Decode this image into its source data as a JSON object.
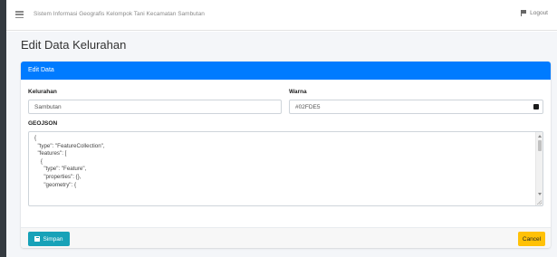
{
  "topbar": {
    "app_title": "Sistem Informasi Geografis Kelompok Tani Kecamatan Sambutan",
    "logout_label": "Logout"
  },
  "page": {
    "title": "Edit Data Kelurahan"
  },
  "card": {
    "header_title": "Edit Data",
    "fields": {
      "kelurahan_label": "Kelurahan",
      "kelurahan_value": "Sambutan",
      "warna_label": "Warna",
      "warna_value": "#02FDE5",
      "geojson_label": "GEOJSON",
      "geojson_value": "{\n  \"type\": \"FeatureCollection\",\n  \"features\": [\n    {\n      \"type\": \"Feature\",\n      \"properties\": {},\n      \"geometry\": {"
    },
    "buttons": {
      "save_label": "Simpan",
      "cancel_label": "Cancel"
    }
  },
  "colors": {
    "header_bg": "#007bff",
    "save_btn": "#17a2b8",
    "cancel_btn": "#ffc107",
    "sidebar": "#343a40"
  },
  "icons": {
    "menu": "hamburger-icon",
    "logout": "flag-icon",
    "save": "floppy-disk-icon",
    "color_picker": "color-swatch-icon"
  }
}
